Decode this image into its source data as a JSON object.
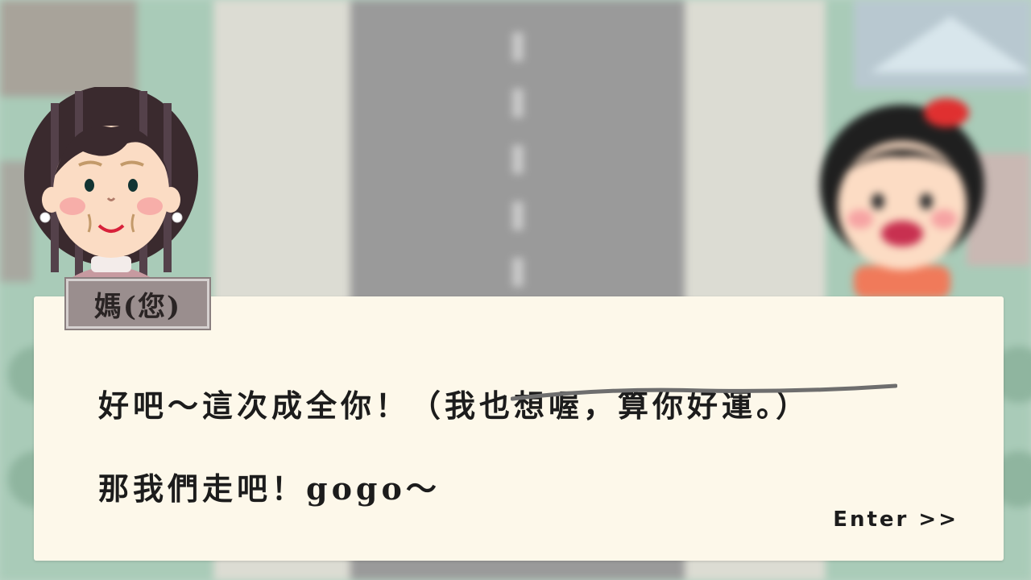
{
  "speaker": {
    "name": "媽(您)"
  },
  "dialog": {
    "line1_main": "好吧～這次成全你！（",
    "line1_struck": "我也想喔，算你好運。",
    "line1_close": "）",
    "line2": "那我們走吧！gogo～"
  },
  "controls": {
    "advance_label": "Enter >>"
  },
  "characters": {
    "left": "mom-avatar",
    "right": "girl-avatar"
  },
  "colors": {
    "dialog_bg": "#fdf8ea",
    "nameplate_bg": "#9a8e8e",
    "strike_line": "#6e6e6e"
  }
}
